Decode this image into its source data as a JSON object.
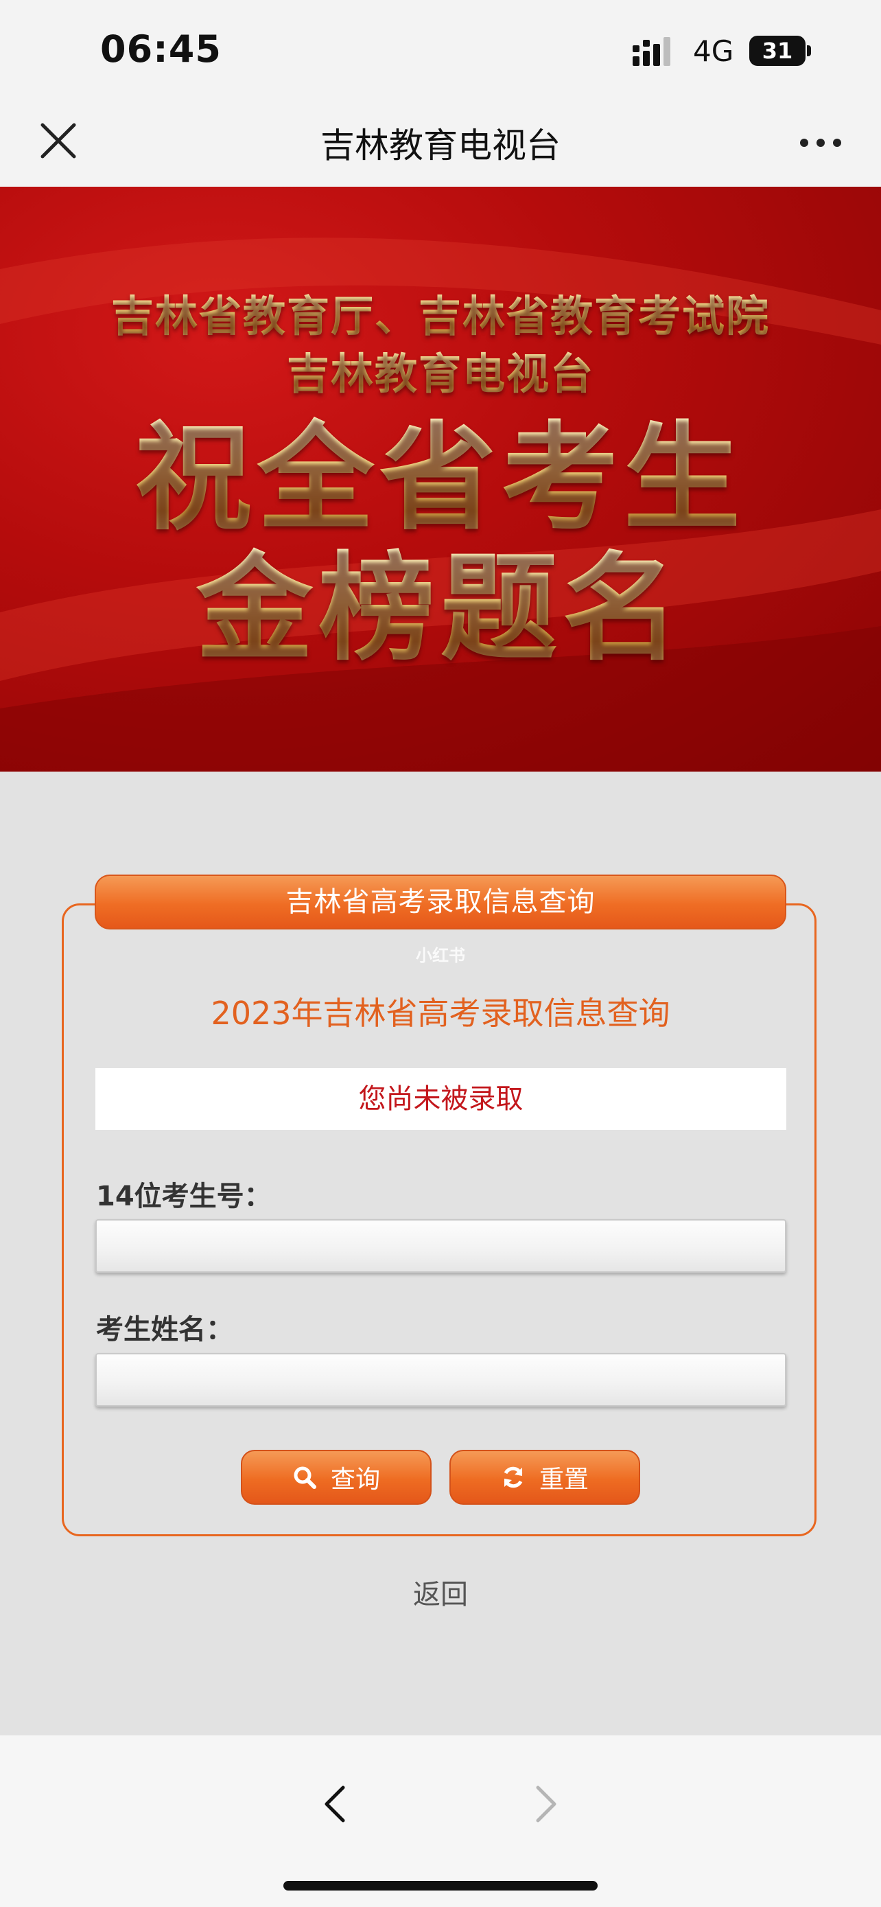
{
  "status_bar": {
    "time": "06:45",
    "network": "4G",
    "battery": "31"
  },
  "nav": {
    "title": "吉林教育电视台",
    "close_icon": "close-icon",
    "more_icon": "more-icon"
  },
  "banner": {
    "line1": "吉林省教育厅、吉林省教育考试院",
    "line2": "吉林教育电视台",
    "line3": "祝全省考生",
    "line4": "金榜题名"
  },
  "form": {
    "header": "吉林省高考录取信息查询",
    "watermark": "小红书",
    "title": "2023年吉林省高考录取信息查询",
    "result": "您尚未被录取",
    "label_id": "14位考生号：",
    "id_value": "",
    "label_name": "考生姓名：",
    "name_value": "",
    "search_label": "查询",
    "reset_label": "重置",
    "back_label": "返回"
  },
  "colors": {
    "accent": "#ef6d24",
    "result_red": "#c3171c",
    "banner_red": "#b50c0c",
    "gold": "#f2d27a"
  }
}
